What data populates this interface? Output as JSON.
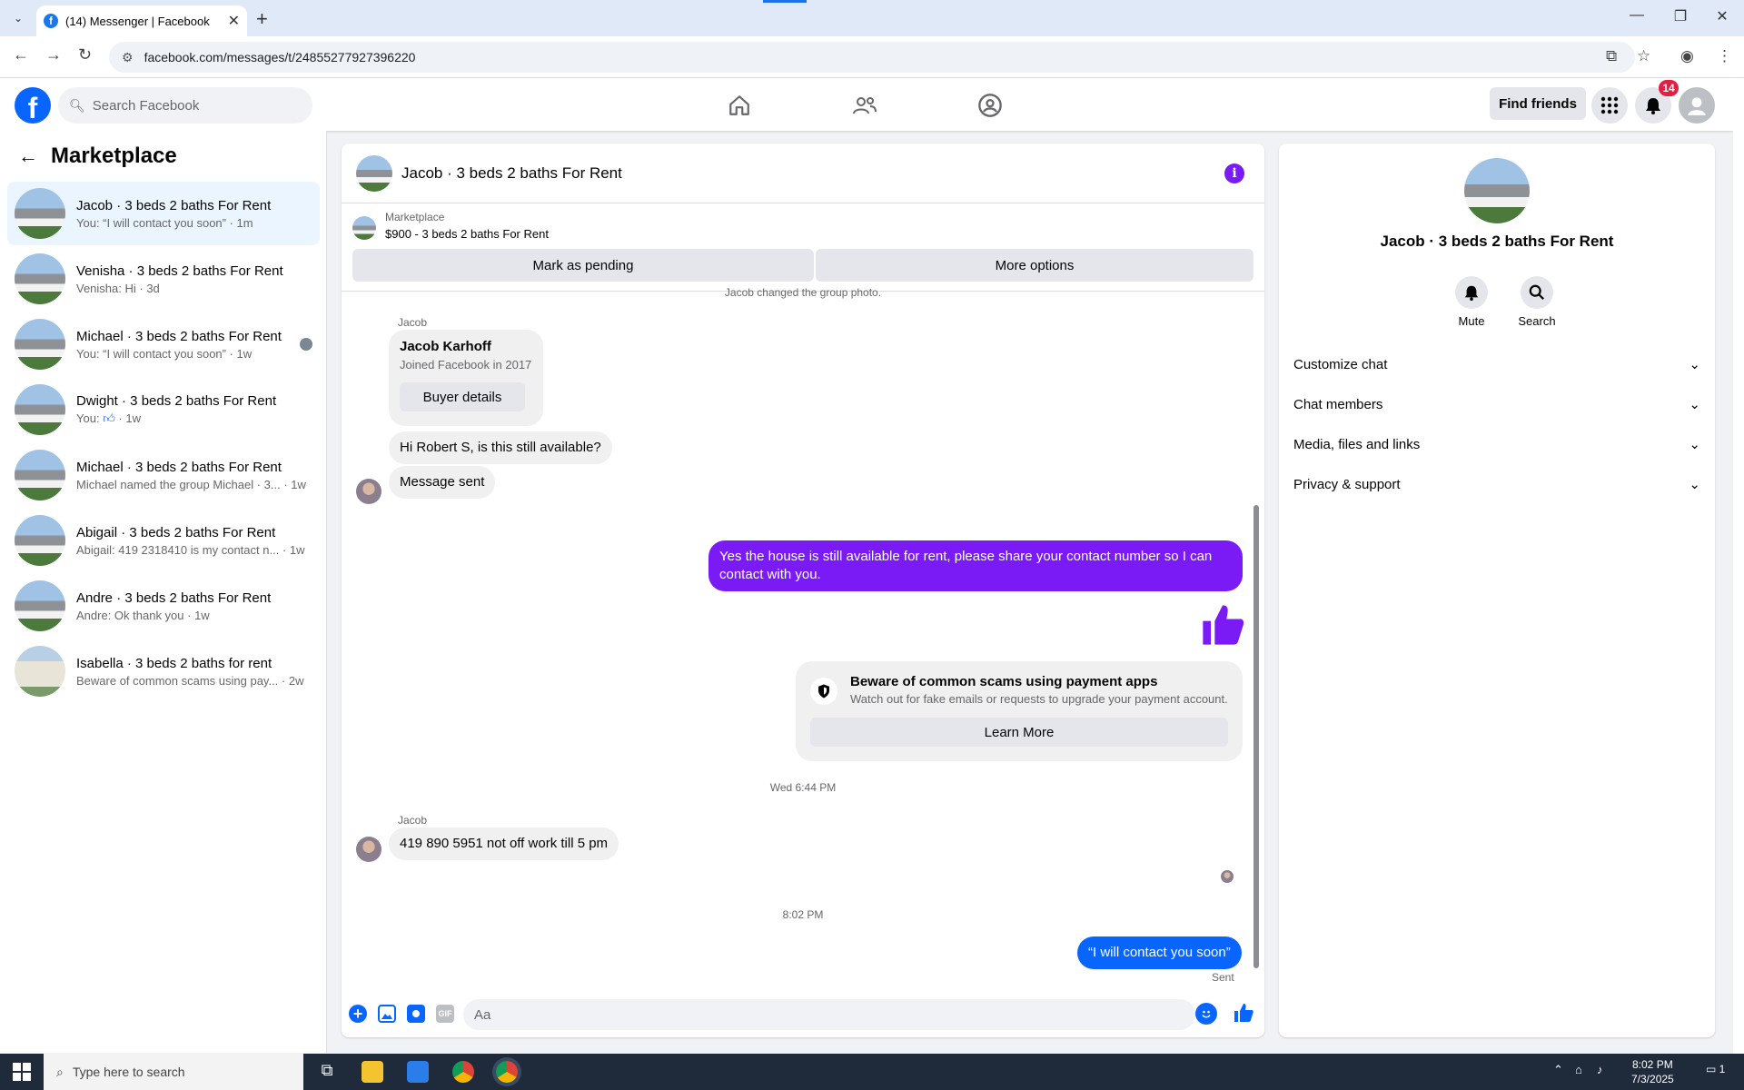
{
  "browser": {
    "tab_title": "(14) Messenger | Facebook",
    "url": "facebook.com/messages/t/24855277927396220"
  },
  "header": {
    "search_placeholder": "Search Facebook",
    "find_friends": "Find friends",
    "notif_count": "14"
  },
  "left": {
    "title": "Marketplace",
    "conversations": [
      {
        "name": "Jacob · 3 beds 2 baths For Rent",
        "preview": "You: “I will contact you soon” · 1m",
        "active": true
      },
      {
        "name": "Venisha · 3 beds 2 baths For Rent",
        "preview": "Venisha: Hi · 3d"
      },
      {
        "name": "Michael · 3 beds 2 baths For Rent",
        "preview": "You: “I will contact you soon” · 1w"
      },
      {
        "name": "Dwight · 3 beds 2 baths For Rent",
        "preview_prefix": "You:",
        "preview_suffix": "· 1w"
      },
      {
        "name": "Michael · 3 beds 2 baths For Rent",
        "preview": "Michael named the group Michael · 3... · 1w"
      },
      {
        "name": "Abigail · 3 beds 2 baths For Rent",
        "preview": "Abigail: 419 2318410 is my contact n... · 1w"
      },
      {
        "name": "Andre · 3 beds 2 baths For Rent",
        "preview": "Andre: Ok thank you · 1w"
      },
      {
        "name": "Isabella · 3 beds 2 baths for rent",
        "preview": "Beware of common scams using pay... · 2w"
      }
    ]
  },
  "chat": {
    "title": "Jacob · 3 beds 2 baths For Rent",
    "marketplace_label": "Marketplace",
    "listing": "$900 - 3 beds 2 baths For Rent",
    "mark_pending": "Mark as pending",
    "more_options": "More options",
    "system_msg": "Jacob changed the group photo.",
    "sender1": "Jacob",
    "card_name": "Jacob Karhoff",
    "card_sub": "Joined Facebook in 2017",
    "card_btn": "Buyer details",
    "msg1": "Hi Robert S, is this still available?",
    "msg2": "Message sent",
    "msg3": "Yes the house is still available for rent, please share your contact number so I can contact with you.",
    "scam_title": "Beware of common scams using payment apps",
    "scam_sub": "Watch out for fake emails or requests to upgrade your payment account.",
    "scam_btn": "Learn More",
    "ts1": "Wed 6:44 PM",
    "sender2": "Jacob",
    "msg4": "419 890 5951 not off work till 5 pm",
    "ts2": "8:02 PM",
    "msg5": "“I will contact you soon”",
    "sent_label": "Sent",
    "composer_placeholder": "Aa"
  },
  "right": {
    "title": "Jacob · 3 beds 2 baths For Rent",
    "mute": "Mute",
    "search": "Search",
    "rows": [
      "Customize chat",
      "Chat members",
      "Media, files and links",
      "Privacy & support"
    ]
  },
  "taskbar": {
    "search_placeholder": "Type here to search",
    "time": "8:02 PM",
    "date": "7/3/2025",
    "notif": "1"
  }
}
